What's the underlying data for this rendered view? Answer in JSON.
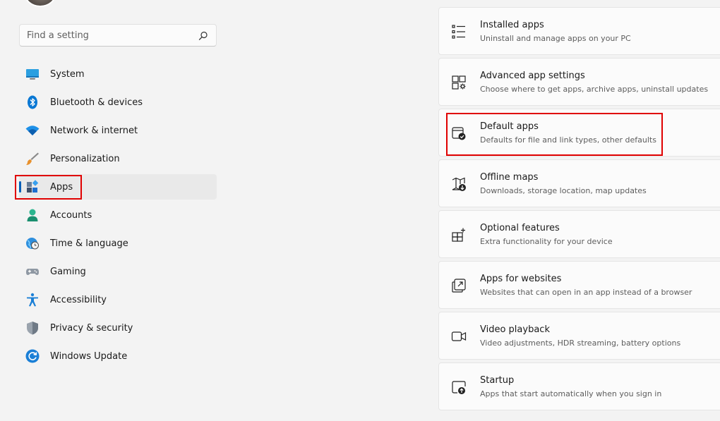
{
  "search": {
    "placeholder": "Find a setting"
  },
  "sidebar": {
    "items": [
      {
        "label": "System",
        "icon": "system-icon"
      },
      {
        "label": "Bluetooth & devices",
        "icon": "bluetooth-icon"
      },
      {
        "label": "Network & internet",
        "icon": "wifi-icon"
      },
      {
        "label": "Personalization",
        "icon": "brush-icon"
      },
      {
        "label": "Apps",
        "icon": "apps-icon",
        "selected": true
      },
      {
        "label": "Accounts",
        "icon": "accounts-icon"
      },
      {
        "label": "Time & language",
        "icon": "globe-clock-icon"
      },
      {
        "label": "Gaming",
        "icon": "gamepad-icon"
      },
      {
        "label": "Accessibility",
        "icon": "accessibility-icon"
      },
      {
        "label": "Privacy & security",
        "icon": "shield-icon"
      },
      {
        "label": "Windows Update",
        "icon": "update-icon"
      }
    ]
  },
  "main": {
    "cards": [
      {
        "title": "Installed apps",
        "description": "Uninstall and manage apps on your PC",
        "icon": "list-icon"
      },
      {
        "title": "Advanced app settings",
        "description": "Choose where to get apps, archive apps, uninstall updates",
        "icon": "app-settings-icon"
      },
      {
        "title": "Default apps",
        "description": "Defaults for file and link types, other defaults",
        "icon": "default-apps-icon"
      },
      {
        "title": "Offline maps",
        "description": "Downloads, storage location, map updates",
        "icon": "map-download-icon"
      },
      {
        "title": "Optional features",
        "description": "Extra functionality for your device",
        "icon": "grid-add-icon"
      },
      {
        "title": "Apps for websites",
        "description": "Websites that can open in an app instead of a browser",
        "icon": "open-external-icon"
      },
      {
        "title": "Video playback",
        "description": "Video adjustments, HDR streaming, battery options",
        "icon": "video-icon"
      },
      {
        "title": "Startup",
        "description": "Apps that start automatically when you sign in",
        "icon": "startup-icon"
      }
    ]
  },
  "colors": {
    "accent": "#005fb8",
    "highlight_box": "#e00000",
    "background": "#f3f3f3",
    "card": "#fbfbfb"
  }
}
